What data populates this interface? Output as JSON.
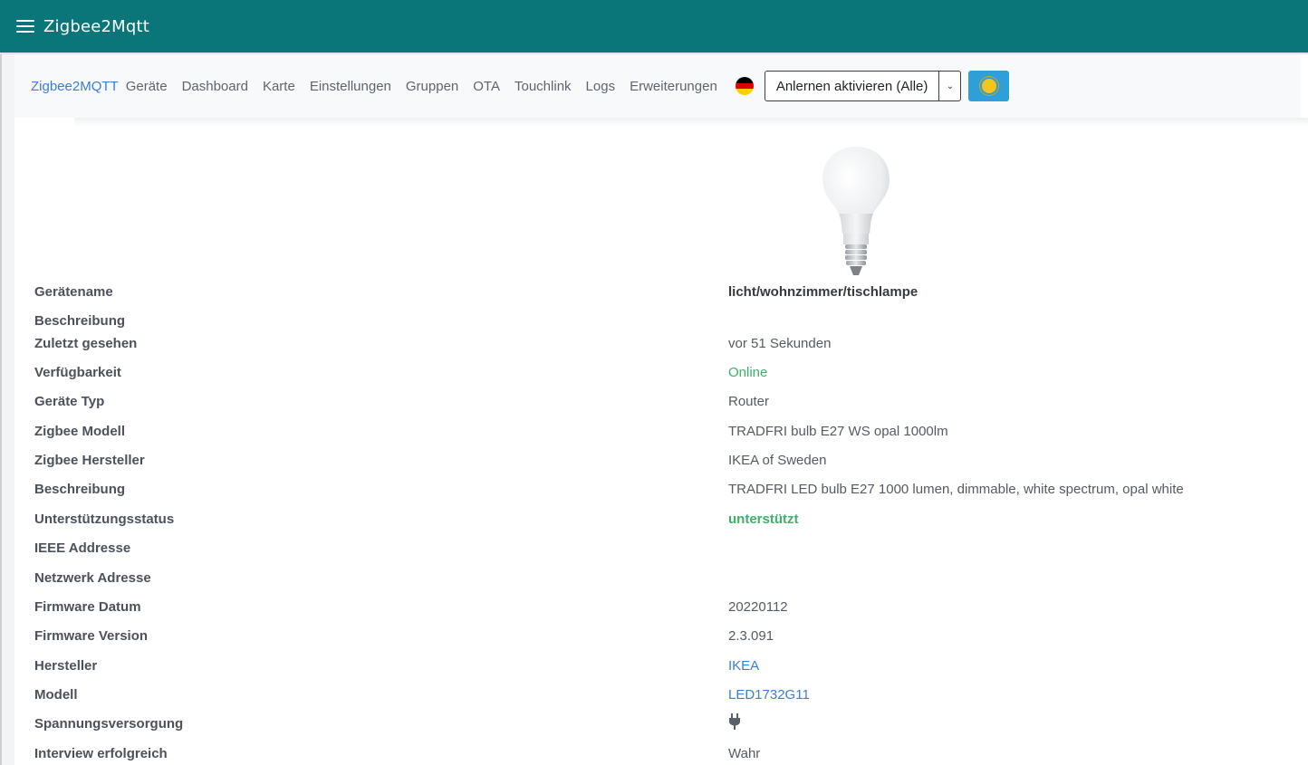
{
  "app": {
    "title": "Zigbee2Mqtt"
  },
  "nav": {
    "brand": "Zigbee2MQTT",
    "links": [
      "Geräte",
      "Dashboard",
      "Karte",
      "Einstellungen",
      "Gruppen",
      "OTA",
      "Touchlink",
      "Logs",
      "Erweiterungen"
    ],
    "language_flag": "german-flag-icon",
    "permit_join": {
      "value": "Anlernen aktivieren (Alle)"
    },
    "theme_icon": "sun-icon"
  },
  "device": {
    "image_icon": "lightbulb-image",
    "rows": [
      {
        "label": "Gerätename",
        "value": "licht/wohnzimmer/tischlampe"
      },
      {
        "label": "Beschreibung",
        "value": ""
      },
      {
        "label": "Zuletzt gesehen",
        "value": "vor 51 Sekunden"
      },
      {
        "label": "Verfügbarkeit",
        "value": "Online"
      },
      {
        "label": "Geräte Typ",
        "value": "Router"
      },
      {
        "label": "Zigbee Modell",
        "value": "TRADFRI bulb E27 WS opal 1000lm"
      },
      {
        "label": "Zigbee Hersteller",
        "value": "IKEA of Sweden"
      },
      {
        "label": "Beschreibung",
        "value": "TRADFRI LED bulb E27 1000 lumen, dimmable, white spectrum, opal white"
      },
      {
        "label": "Unterstützungsstatus",
        "value": "unterstützt"
      },
      {
        "label": "IEEE Addresse",
        "value": ""
      },
      {
        "label": "Netzwerk Adresse",
        "value": ""
      },
      {
        "label": "Firmware Datum",
        "value": "20220112"
      },
      {
        "label": "Firmware Version",
        "value": "2.3.091"
      },
      {
        "label": "Hersteller",
        "value": "IKEA"
      },
      {
        "label": "Modell",
        "value": "LED1732G11"
      },
      {
        "label": "Spannungsversorgung",
        "value": "",
        "icon": "plug-icon"
      },
      {
        "label": "Interview erfolgreich",
        "value": "Wahr"
      }
    ]
  },
  "colors": {
    "topbar": "#0b7679",
    "link": "#3b7dd8",
    "online": "#3db26a",
    "theme_button": "#2f9fd9"
  }
}
